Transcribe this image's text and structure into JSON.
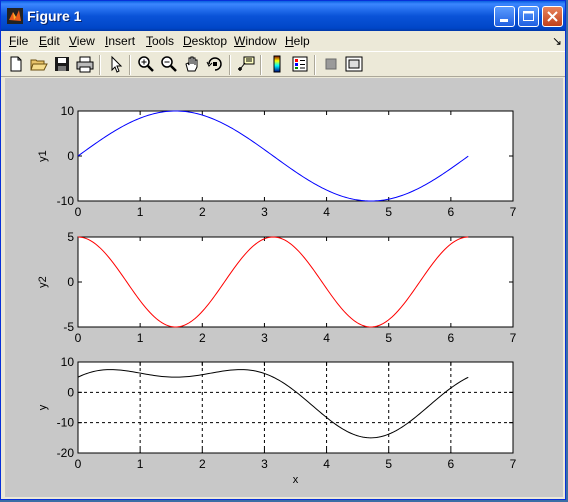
{
  "window": {
    "title": "Figure 1"
  },
  "menu": [
    {
      "key": "F",
      "rest": "ile"
    },
    {
      "key": "E",
      "rest": "dit"
    },
    {
      "key": "V",
      "rest": "iew"
    },
    {
      "key": "I",
      "rest": "nsert"
    },
    {
      "key": "T",
      "rest": "ools"
    },
    {
      "key": "D",
      "rest": "esktop"
    },
    {
      "key": "W",
      "rest": "indow"
    },
    {
      "key": "H",
      "rest": "elp"
    }
  ],
  "menu_arrow": "↘",
  "toolbar_icons": [
    "new-file-icon",
    "open-folder-icon",
    "save-icon",
    "print-icon",
    "select-arrow-icon",
    "zoom-in-icon",
    "zoom-out-icon",
    "pan-hand-icon",
    "rotate-3d-icon",
    "data-cursor-icon",
    "colorbar-icon",
    "legend-icon",
    "hide-plot-tools-icon",
    "show-plot-tools-icon"
  ],
  "chart_data": [
    {
      "type": "line",
      "xlabel": "",
      "ylabel": "y1",
      "xlim": [
        0,
        7
      ],
      "ylim": [
        -10,
        10
      ],
      "xticks": [
        0,
        1,
        2,
        3,
        4,
        5,
        6,
        7
      ],
      "yticks": [
        10,
        0,
        -10
      ],
      "grid": false,
      "series": [
        {
          "function": "10*sin(x)",
          "x_range": [
            0,
            6.28
          ],
          "color": "#0000ff"
        }
      ]
    },
    {
      "type": "line",
      "xlabel": "",
      "ylabel": "y2",
      "xlim": [
        0,
        7
      ],
      "ylim": [
        -5,
        5
      ],
      "xticks": [
        0,
        1,
        2,
        3,
        4,
        5,
        6,
        7
      ],
      "yticks": [
        5,
        0,
        -5
      ],
      "grid": false,
      "series": [
        {
          "function": "5*cos(2x)",
          "x_range": [
            0,
            6.28
          ],
          "color": "#ff0000"
        }
      ]
    },
    {
      "type": "line",
      "xlabel": "x",
      "ylabel": "y",
      "xlim": [
        0,
        7
      ],
      "ylim": [
        -20,
        10
      ],
      "xticks": [
        0,
        1,
        2,
        3,
        4,
        5,
        6,
        7
      ],
      "yticks": [
        10,
        0,
        -10,
        -20
      ],
      "grid": true,
      "series": [
        {
          "function": "10*sin(x)+5*cos(2x)",
          "x_range": [
            0,
            6.28
          ],
          "color": "#000000"
        }
      ]
    }
  ]
}
